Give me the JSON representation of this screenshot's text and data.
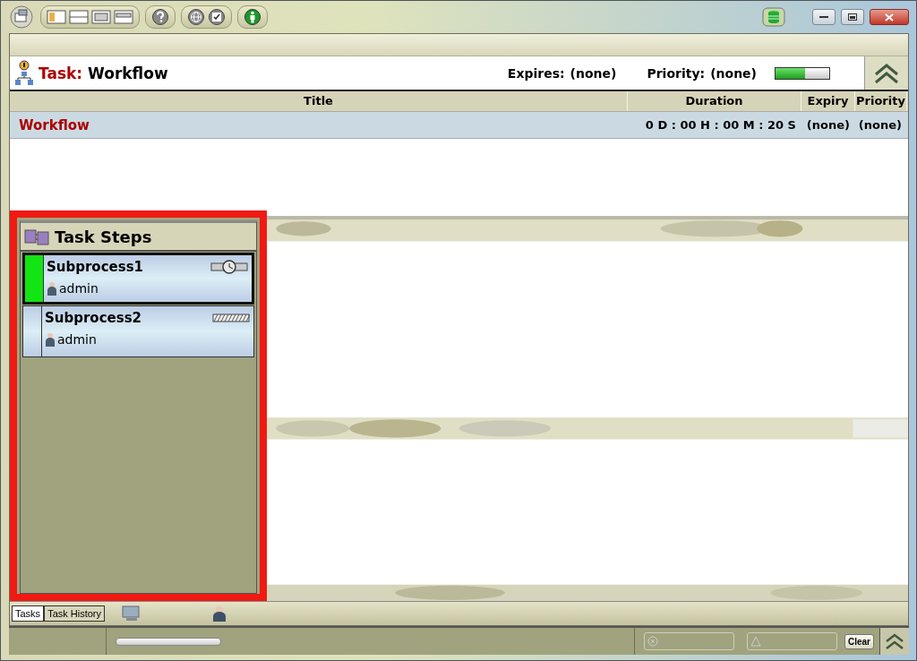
{
  "task": {
    "label": "Task:",
    "name": "Workflow",
    "expires_label": "Expires:",
    "expires": "(none)",
    "priority_label": "Priority:",
    "priority": "(none)",
    "progress": {
      "level": 0.55
    }
  },
  "table": {
    "columns": [
      "Title",
      "Duration",
      "Expiry",
      "Priority"
    ],
    "rows": [
      {
        "title": "Workflow",
        "duration": "0 D : 00 H : 00 M : 20 S",
        "expiry": "(none)",
        "priority": "(none)",
        "selected": true
      }
    ]
  },
  "task_steps": {
    "title": "Task Steps",
    "items": [
      {
        "name": "Subprocess1",
        "user": "admin",
        "selected": true,
        "kind": "running"
      },
      {
        "name": "Subprocess2",
        "user": "admin",
        "selected": false,
        "kind": "pending"
      }
    ]
  },
  "bottom_tabs": [
    {
      "label": "Tasks",
      "selected": true
    },
    {
      "label": "Task History",
      "selected": false
    }
  ],
  "status_bar": {
    "clear_button": "Clear"
  }
}
